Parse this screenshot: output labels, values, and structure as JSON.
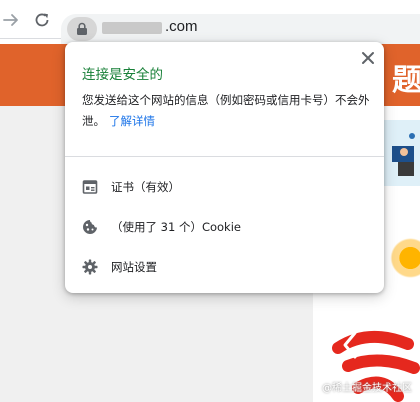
{
  "toolbar": {
    "url_suffix": ".com",
    "forward_icon": "arrow-right-icon",
    "reload_icon": "reload-icon",
    "lock_icon": "lock-icon"
  },
  "page": {
    "banner_char": "题",
    "watermark": "@稀土掘金技术社区"
  },
  "popup": {
    "title": "连接是安全的",
    "description": "您发送给这个网站的信息（例如密码或信用卡号）不会外泄。",
    "learn_more": "了解详情",
    "items": [
      {
        "icon": "certificate-icon",
        "label": "证书（有效）"
      },
      {
        "icon": "cookie-icon",
        "label": "（使用了 31 个）Cookie"
      },
      {
        "icon": "gear-icon",
        "label": "网站设置"
      }
    ]
  },
  "colors": {
    "secure_green": "#188038",
    "link_blue": "#1a73e8",
    "banner_orange": "#e0632b"
  }
}
